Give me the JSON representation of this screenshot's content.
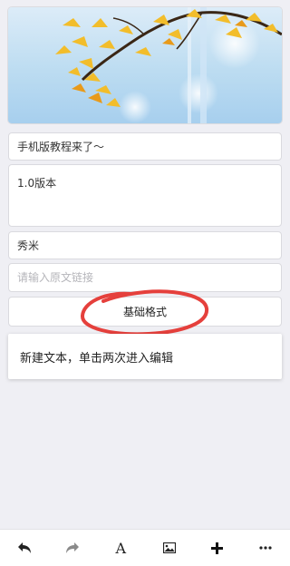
{
  "cover": {
    "image_icon": "ginkgo-branch-photo"
  },
  "form": {
    "title_value": "手机版教程来了～",
    "summary_value": "1.0版本",
    "author_value": "秀米",
    "link_placeholder": "请输入原文链接"
  },
  "format_button_label": "基础格式",
  "editor": {
    "placeholder_text": "新建文本，单击两次进入编辑"
  },
  "toolbar": {
    "items": [
      {
        "icon": "undo-icon"
      },
      {
        "icon": "redo-icon"
      },
      {
        "icon": "font-icon",
        "label": "A"
      },
      {
        "icon": "image-icon"
      },
      {
        "icon": "add-icon"
      },
      {
        "icon": "more-icon"
      }
    ]
  },
  "colors": {
    "background": "#efeff4",
    "annotation_red": "#e5403c",
    "ginkgo_yellow": "#f2bd2b"
  }
}
